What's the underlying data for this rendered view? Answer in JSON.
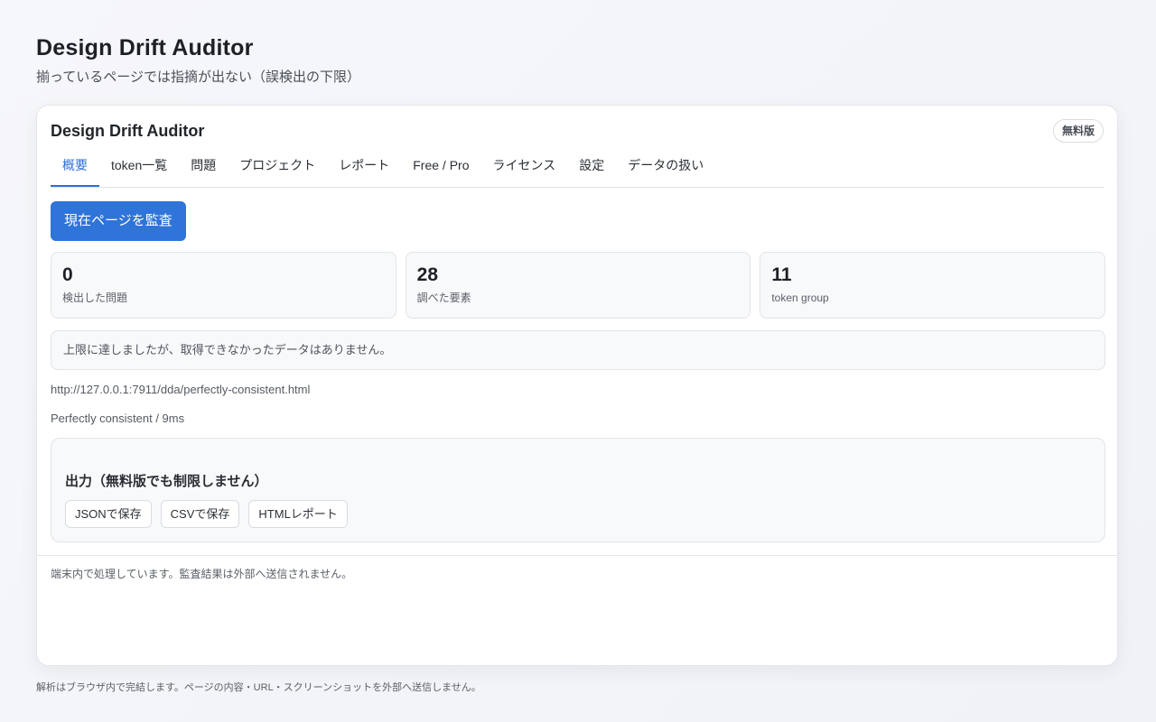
{
  "page": {
    "title": "Design Drift Auditor",
    "subtitle": "揃っているページでは指摘が出ない（誤検出の下限）",
    "footer": "解析はブラウザ内で完結します。ページの内容・URL・スクリーンショットを外部へ送信しません。"
  },
  "card": {
    "title": "Design Drift Auditor",
    "badge": "無料版",
    "tabs": [
      {
        "label": "概要",
        "active": true
      },
      {
        "label": "token一覧",
        "active": false
      },
      {
        "label": "問題",
        "active": false
      },
      {
        "label": "プロジェクト",
        "active": false
      },
      {
        "label": "レポート",
        "active": false
      },
      {
        "label": "Free / Pro",
        "active": false
      },
      {
        "label": "ライセンス",
        "active": false
      },
      {
        "label": "設定",
        "active": false
      },
      {
        "label": "データの扱い",
        "active": false
      }
    ],
    "audit_button": "現在ページを監査",
    "stats": [
      {
        "value": "0",
        "label": "検出した問題"
      },
      {
        "value": "28",
        "label": "調べた要素"
      },
      {
        "value": "11",
        "label": "token group"
      }
    ],
    "notice": "上限に達しましたが、取得できなかったデータはありません。",
    "url": "http://127.0.0.1:7911/dda/perfectly-consistent.html",
    "result": "Perfectly consistent / 9ms",
    "export": {
      "title": "出力（無料版でも制限しません）",
      "buttons": [
        "JSONで保存",
        "CSVで保存",
        "HTMLレポート"
      ]
    },
    "privacy_note": "端末内で処理しています。監査結果は外部へ送信されません。"
  },
  "colors": {
    "accent": "#2f74d8",
    "active_tab": "#2f6fd6",
    "background": "#f3f5f8",
    "card": "#ffffff"
  }
}
